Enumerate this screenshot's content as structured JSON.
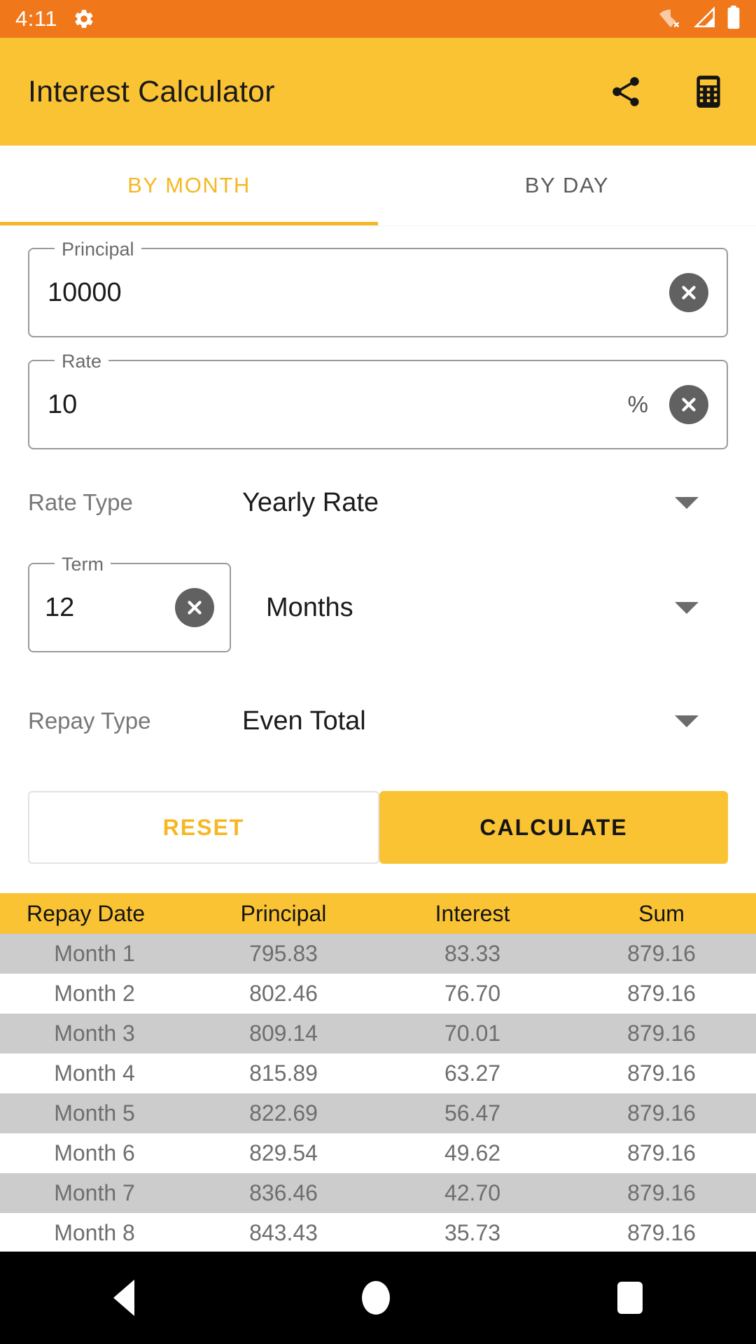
{
  "status_bar": {
    "time": "4:11",
    "gear_icon": "gear-icon",
    "wifi_icon": "wifi-off-icon",
    "signal_icon": "cellular-signal-icon",
    "battery_icon": "battery-full-icon",
    "background": "#F0771A"
  },
  "app_bar": {
    "title": "Interest Calculator",
    "share_icon": "share-icon",
    "calculator_icon": "calculator-icon",
    "background": "#F9C333"
  },
  "tabs": {
    "items": [
      {
        "label": "BY MONTH",
        "active": true
      },
      {
        "label": "BY DAY",
        "active": false
      }
    ],
    "indicator_color": "#F5B824"
  },
  "form": {
    "principal": {
      "label": "Principal",
      "value": "10000",
      "clear_icon": "clear-icon"
    },
    "rate": {
      "label": "Rate",
      "value": "10",
      "suffix": "%",
      "clear_icon": "clear-icon"
    },
    "rate_type": {
      "label": "Rate Type",
      "value": "Yearly Rate",
      "caret_icon": "chevron-down-icon"
    },
    "term": {
      "label": "Term",
      "value": "12",
      "clear_icon": "clear-icon",
      "unit": "Months",
      "unit_caret_icon": "chevron-down-icon"
    },
    "repay_type": {
      "label": "Repay Type",
      "value": "Even Total",
      "caret_icon": "chevron-down-icon"
    },
    "buttons": {
      "reset": "RESET",
      "calculate": "CALCULATE"
    }
  },
  "table": {
    "headers": [
      "Repay Date",
      "Principal",
      "Interest",
      "Sum"
    ],
    "rows": [
      [
        "Month 1",
        "795.83",
        "83.33",
        "879.16"
      ],
      [
        "Month 2",
        "802.46",
        "76.70",
        "879.16"
      ],
      [
        "Month 3",
        "809.14",
        "70.01",
        "879.16"
      ],
      [
        "Month 4",
        "815.89",
        "63.27",
        "879.16"
      ],
      [
        "Month 5",
        "822.69",
        "56.47",
        "879.16"
      ],
      [
        "Month 6",
        "829.54",
        "49.62",
        "879.16"
      ],
      [
        "Month 7",
        "836.46",
        "42.70",
        "879.16"
      ],
      [
        "Month 8",
        "843.43",
        "35.73",
        "879.16"
      ]
    ]
  },
  "nav_bar": {
    "back_icon": "back-triangle-icon",
    "home_icon": "home-circle-icon",
    "recents_icon": "recents-square-icon"
  }
}
